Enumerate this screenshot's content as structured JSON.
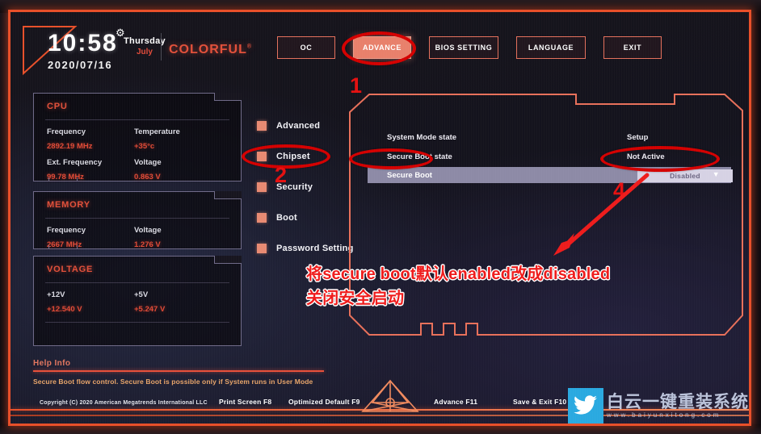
{
  "header": {
    "time": "10:58",
    "date": "2020/07/16",
    "day_of_week": "Thursday",
    "month": "July",
    "brand": "COLORFUL",
    "brand_tm": "®",
    "gear_icon": "gear-icon"
  },
  "topnav": [
    {
      "label": "OC",
      "active": false
    },
    {
      "label": "ADVANCE",
      "active": true
    },
    {
      "label": "BIOS SETTING",
      "active": false
    },
    {
      "label": "LANGUAGE",
      "active": false
    },
    {
      "label": "EXIT",
      "active": false
    }
  ],
  "info_panels": [
    {
      "title": "CPU",
      "rows": [
        [
          {
            "label": "Frequency",
            "value": "2892.19 MHz"
          },
          {
            "label": "Temperature",
            "value": "+35°c"
          }
        ],
        [
          {
            "label": "Ext. Frequency",
            "value": "99.78 MHz"
          },
          {
            "label": "Voltage",
            "value": "0.863 V"
          }
        ]
      ]
    },
    {
      "title": "MEMORY",
      "rows": [
        [
          {
            "label": "Frequency",
            "value": "2667 MHz"
          },
          {
            "label": "Voltage",
            "value": "1.276 V"
          }
        ]
      ]
    },
    {
      "title": "VOLTAGE",
      "rows": [
        [
          {
            "label": "+12V",
            "value": "+12.540 V"
          },
          {
            "label": "+5V",
            "value": "+5.247 V"
          }
        ]
      ]
    }
  ],
  "help": {
    "title": "Help Info",
    "text": "Secure Boot flow control. Secure Boot is possible only if System runs in User Mode"
  },
  "menu": [
    {
      "label": "Advanced"
    },
    {
      "label": "Chipset"
    },
    {
      "label": "Security"
    },
    {
      "label": "Boot"
    },
    {
      "label": "Password Setting"
    }
  ],
  "content": {
    "rows": [
      {
        "label": "System Mode state",
        "value": "Setup",
        "type": "text"
      },
      {
        "label": "Secure Boot state",
        "value": "Not Active",
        "type": "text"
      },
      {
        "label": "Secure Boot",
        "value": "Disabled",
        "type": "dropdown",
        "caret": "▼"
      }
    ]
  },
  "footer": {
    "copyright": "Copyright (C) 2020 American Megatrends International LLC",
    "items": [
      {
        "label": "Print Screen F8"
      },
      {
        "label": "Optimized Default F9"
      },
      {
        "label": "Advance F11"
      },
      {
        "label": "Save & Exit F10"
      }
    ]
  },
  "annotations": {
    "numbers": [
      {
        "text": "1"
      },
      {
        "text": "2"
      },
      {
        "text": "4"
      }
    ],
    "lines": [
      "将secure boot默认enabled改成disabled",
      "关闭安全启动"
    ]
  },
  "watermark": {
    "icon": "twitter-bird-icon",
    "cn": "白云一键重装系统",
    "url": "www.baiyunxitong.com"
  },
  "colors": {
    "accent_red": "#e2503a",
    "frame_orange": "#e8502a",
    "bullet_salmon": "#e88a72",
    "anno_red": "#e51010",
    "selected_row": "#8d8aa6",
    "dropdown_bg": "#d6d2e4",
    "watermark_blue": "#2aa9e0"
  }
}
